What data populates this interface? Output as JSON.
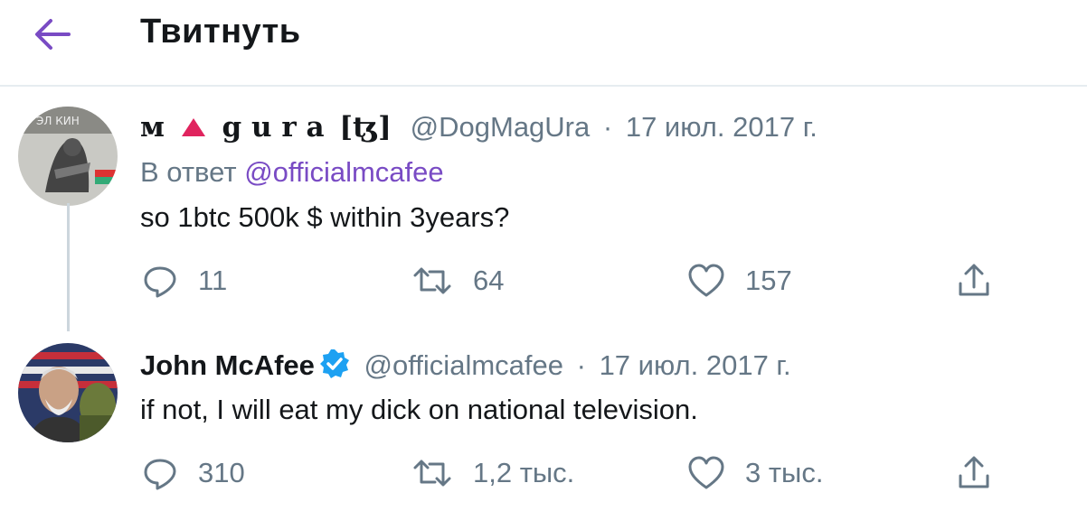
{
  "header": {
    "title": "Твитнуть",
    "back_icon": "arrow-left-icon",
    "accent": "#794bc4"
  },
  "tweets": [
    {
      "display_name": "м ▲ gura [ꜩ]",
      "name_parts": [
        "м",
        "g u r a",
        "[ꜩ]"
      ],
      "handle": "@DogMagUra",
      "separator": "·",
      "date": "17 июл. 2017 г.",
      "reply_prefix": "В ответ",
      "reply_to": "@officialmcafee",
      "text": "so 1btc 500k $ within 3years?",
      "reply_count": "11",
      "retweet_count": "64",
      "like_count": "157"
    },
    {
      "display_name": "John McAfee",
      "verified": true,
      "handle": "@officialmcafee",
      "separator": "·",
      "date": "17 июл. 2017 г.",
      "text": "if not, I will eat my dick on national television.",
      "reply_count": "310",
      "retweet_count": "1,2 тыс.",
      "like_count": "3 тыс."
    }
  ],
  "colors": {
    "text": "#14171a",
    "muted": "#657786",
    "mention": "#794bc4",
    "verified": "#1da1f2",
    "triangle": "#e0245e"
  }
}
